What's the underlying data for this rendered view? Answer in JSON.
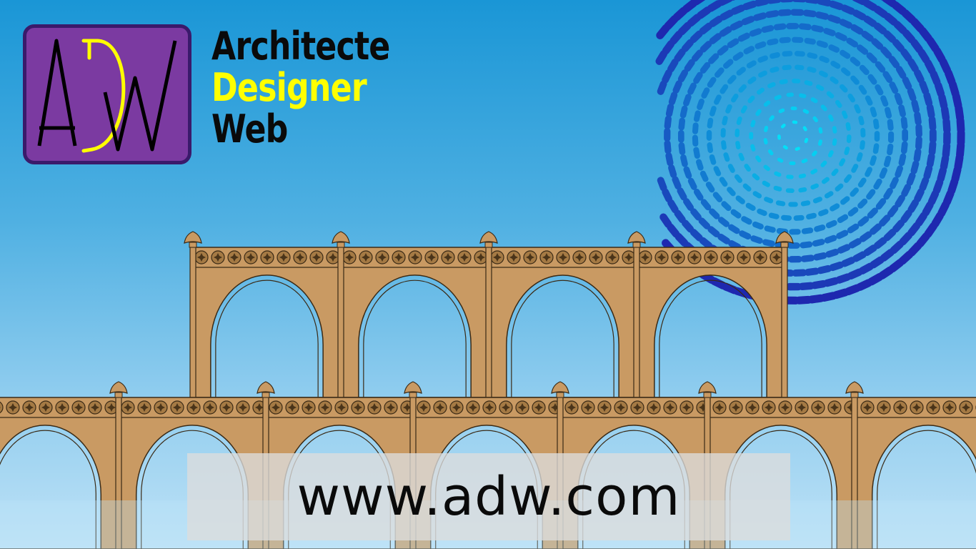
{
  "brand": {
    "logo_letters": "ADW",
    "line1": "Architecte",
    "line2": "Designer",
    "line3": "Web"
  },
  "website": {
    "url": "www.adw.com"
  },
  "colors": {
    "logo_background": "#7b3aa1",
    "logo_border": "#3a1a6b",
    "accent_yellow": "#ffff00",
    "text_black": "#0a0a0a",
    "aqueduct_stone": "#c99a63",
    "sky_top": "#1a96d6",
    "sky_bottom": "#bfe2f6"
  },
  "icons": {
    "globe": "dotted-sphere-icon",
    "medallion": "star-medallion-icon",
    "finial": "finial-icon"
  }
}
